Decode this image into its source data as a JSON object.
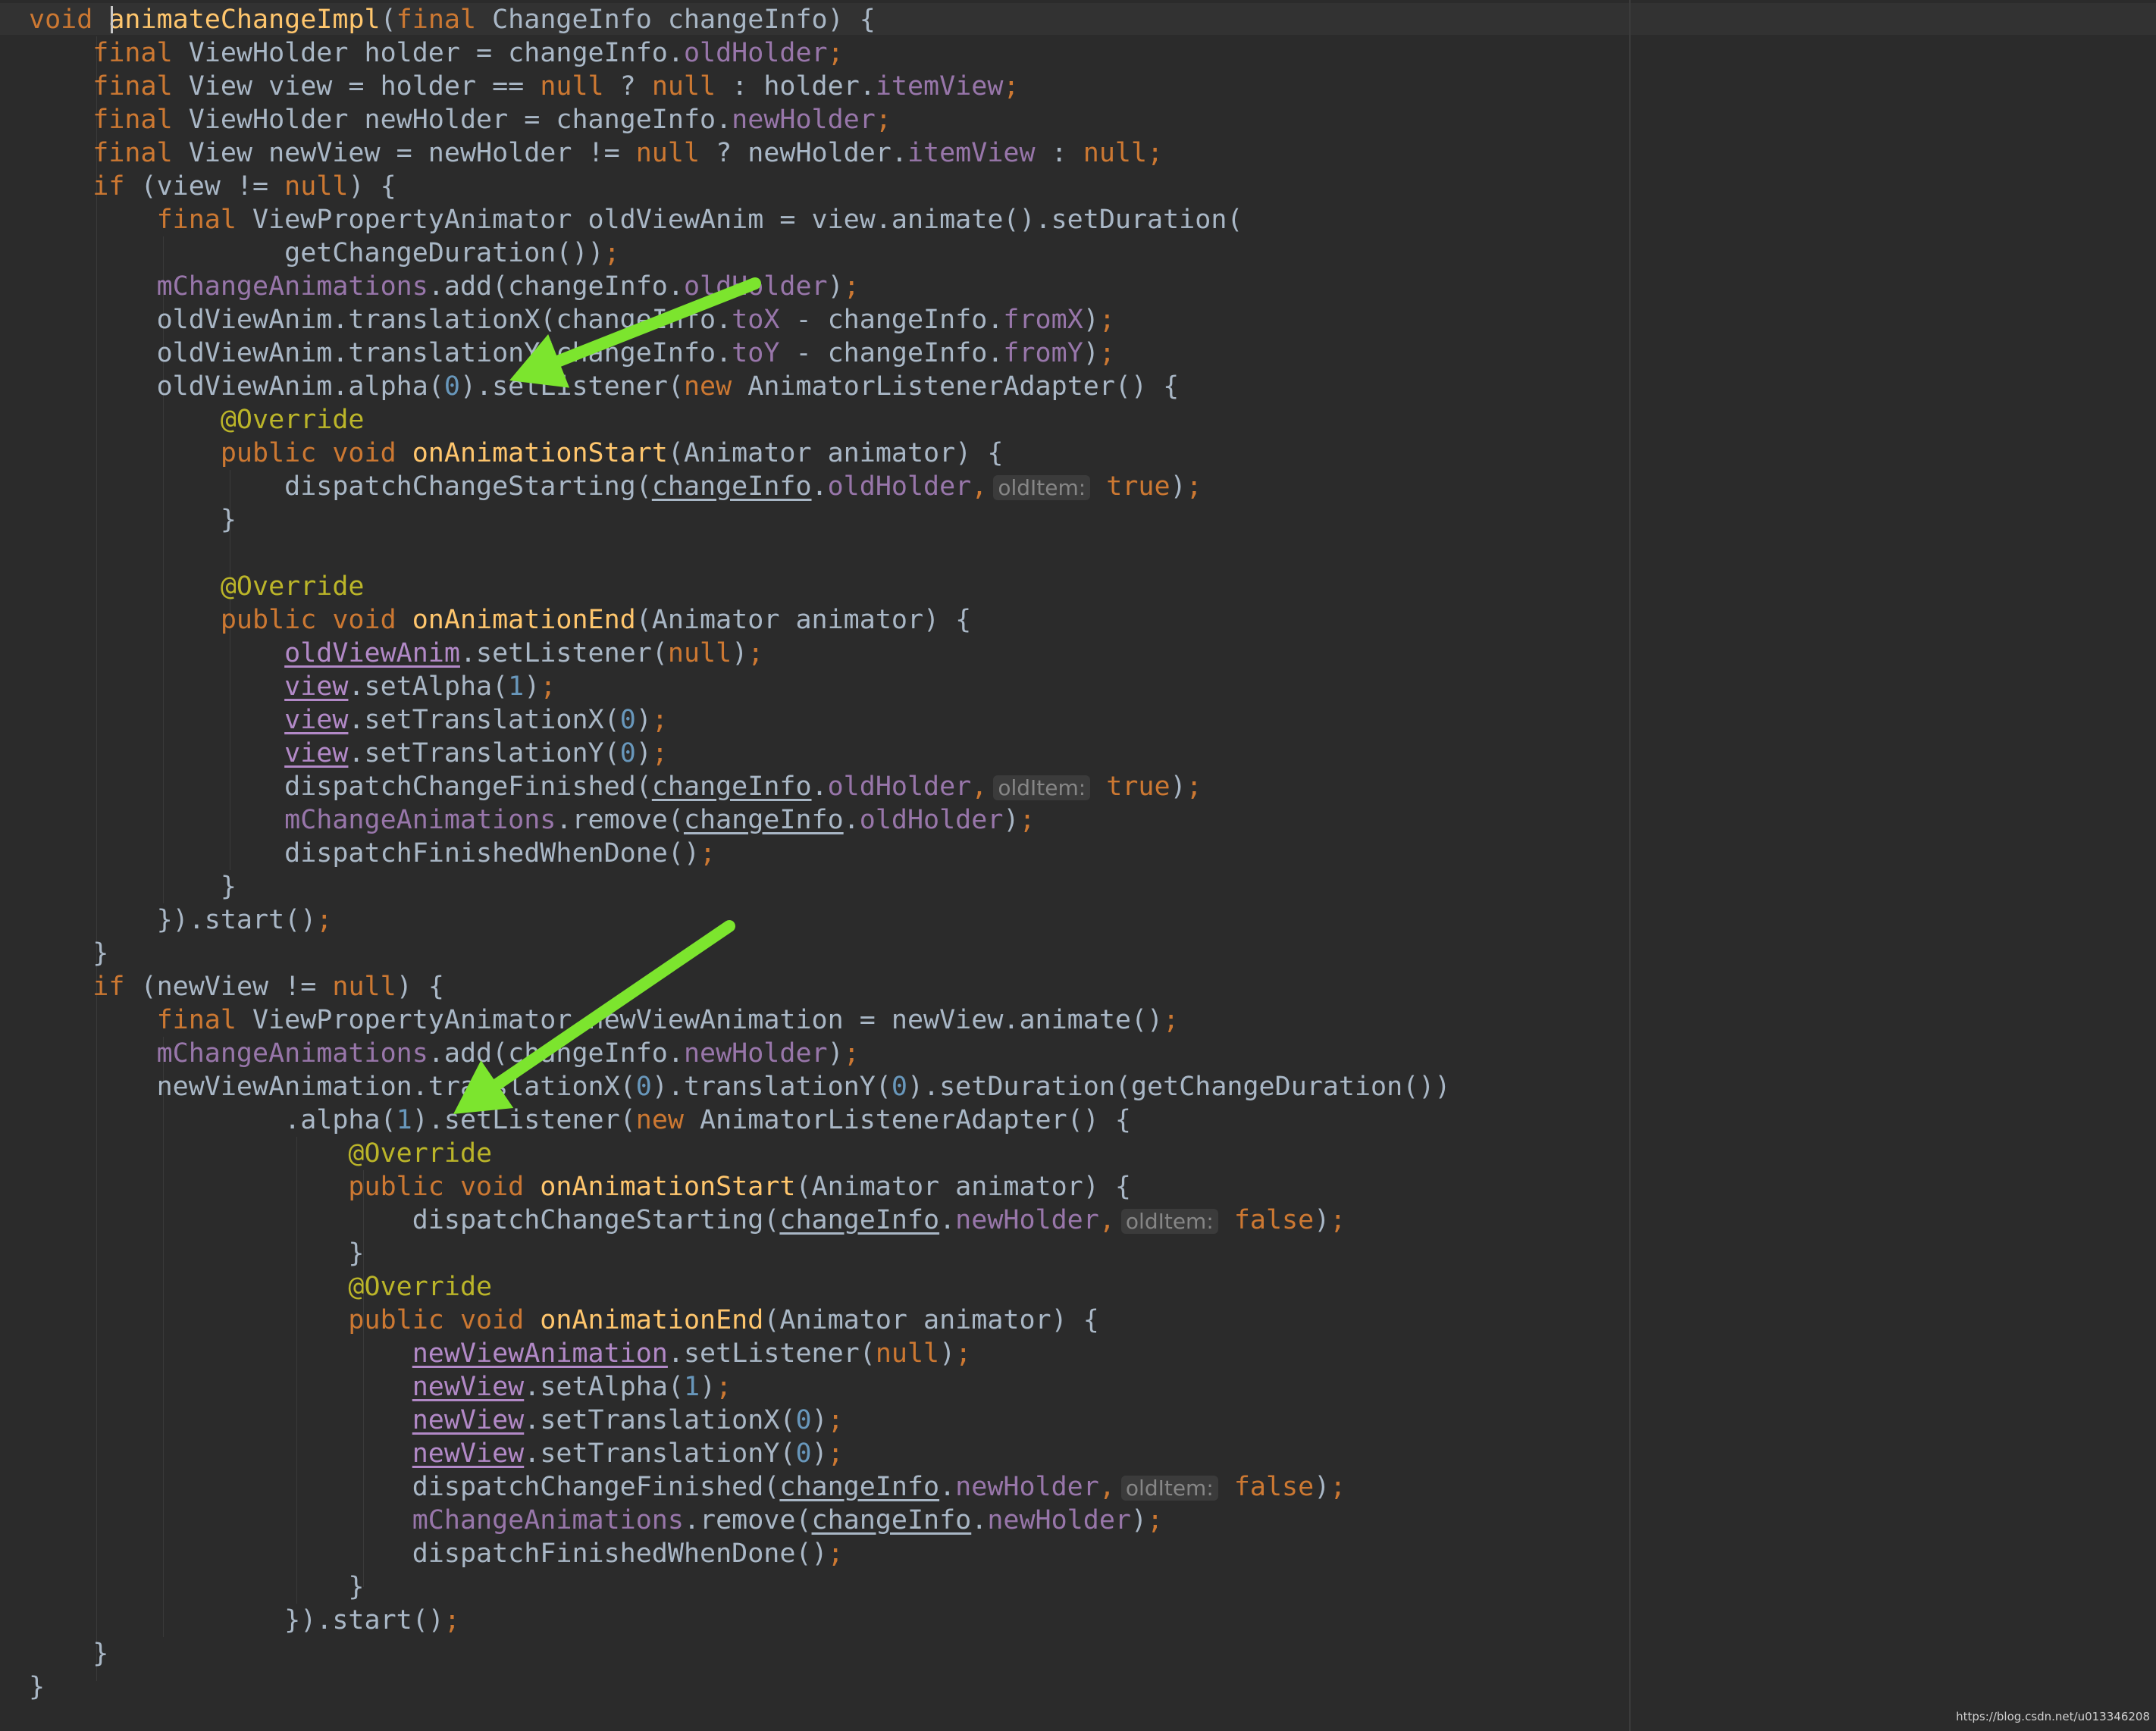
{
  "editor": {
    "caret_line": 1,
    "lines": [
      [
        [
          "kw",
          "void "
        ],
        [
          "fn",
          "animateChangeImpl"
        ],
        [
          "txt",
          "("
        ],
        [
          "kw",
          "final "
        ],
        [
          "txt",
          "ChangeInfo changeInfo) {"
        ]
      ],
      [
        [
          "kw",
          "    final "
        ],
        [
          "txt",
          "ViewHolder holder = changeInfo."
        ],
        [
          "fld",
          "oldHolder"
        ],
        [
          "kw",
          ";"
        ]
      ],
      [
        [
          "kw",
          "    final "
        ],
        [
          "txt",
          "View view = holder == "
        ],
        [
          "kw",
          "null "
        ],
        [
          "txt",
          "? "
        ],
        [
          "kw",
          "null "
        ],
        [
          "txt",
          ": holder."
        ],
        [
          "fld",
          "itemView"
        ],
        [
          "kw",
          ";"
        ]
      ],
      [
        [
          "kw",
          "    final "
        ],
        [
          "txt",
          "ViewHolder newHolder = changeInfo."
        ],
        [
          "fld",
          "newHolder"
        ],
        [
          "kw",
          ";"
        ]
      ],
      [
        [
          "kw",
          "    final "
        ],
        [
          "txt",
          "View newView = newHolder != "
        ],
        [
          "kw",
          "null "
        ],
        [
          "txt",
          "? newHolder."
        ],
        [
          "fld",
          "itemView "
        ],
        [
          "txt",
          ": "
        ],
        [
          "kw",
          "null;"
        ]
      ],
      [
        [
          "kw",
          "    if "
        ],
        [
          "txt",
          "(view != "
        ],
        [
          "kw",
          "null"
        ],
        [
          "txt",
          ") {"
        ]
      ],
      [
        [
          "kw",
          "        final "
        ],
        [
          "txt",
          "ViewPropertyAnimator oldViewAnim = view.animate().setDuration("
        ]
      ],
      [
        [
          "txt",
          "                getChangeDuration())"
        ],
        [
          "kw",
          ";"
        ]
      ],
      [
        [
          "fld",
          "        mChangeAnimations"
        ],
        [
          "txt",
          ".add(changeInfo."
        ],
        [
          "fld",
          "oldHolder"
        ],
        [
          "txt",
          ")"
        ],
        [
          "kw",
          ";"
        ]
      ],
      [
        [
          "txt",
          "        oldViewAnim.translationX(changeInfo."
        ],
        [
          "fld",
          "toX "
        ],
        [
          "txt",
          "- changeInfo."
        ],
        [
          "fld",
          "fromX"
        ],
        [
          "txt",
          ")"
        ],
        [
          "kw",
          ";"
        ]
      ],
      [
        [
          "txt",
          "        oldViewAnim.translationY(changeInfo."
        ],
        [
          "fld",
          "toY "
        ],
        [
          "txt",
          "- changeInfo."
        ],
        [
          "fld",
          "fromY"
        ],
        [
          "txt",
          ")"
        ],
        [
          "kw",
          ";"
        ]
      ],
      [
        [
          "txt",
          "        oldViewAnim.alpha("
        ],
        [
          "num",
          "0"
        ],
        [
          "txt",
          ").setListener("
        ],
        [
          "kw",
          "new "
        ],
        [
          "txt",
          "AnimatorListenerAdapter() {"
        ]
      ],
      [
        [
          "ann",
          "            @Override"
        ]
      ],
      [
        [
          "kw",
          "            public void "
        ],
        [
          "fn",
          "onAnimationStart"
        ],
        [
          "txt",
          "(Animator animator) {"
        ]
      ],
      [
        [
          "txt",
          "                dispatchChangeStarting("
        ],
        [
          "undv",
          "changeInfo"
        ],
        [
          "txt",
          "."
        ],
        [
          "fld",
          "oldHolder"
        ],
        [
          "kw",
          ","
        ],
        [
          "hint",
          "oldItem:"
        ],
        [
          "kw",
          " true"
        ],
        [
          "txt",
          ")"
        ],
        [
          "kw",
          ";"
        ]
      ],
      [
        [
          "txt",
          "            }"
        ]
      ],
      [
        [
          "txt",
          ""
        ]
      ],
      [
        [
          "ann",
          "            @Override"
        ]
      ],
      [
        [
          "kw",
          "            public void "
        ],
        [
          "fn",
          "onAnimationEnd"
        ],
        [
          "txt",
          "(Animator animator) {"
        ]
      ],
      [
        [
          "txt",
          "                "
        ],
        [
          "und",
          "oldViewAnim"
        ],
        [
          "txt",
          ".setListener("
        ],
        [
          "kw",
          "null"
        ],
        [
          "txt",
          ")"
        ],
        [
          "kw",
          ";"
        ]
      ],
      [
        [
          "txt",
          "                "
        ],
        [
          "und",
          "view"
        ],
        [
          "txt",
          ".setAlpha("
        ],
        [
          "num",
          "1"
        ],
        [
          "txt",
          ")"
        ],
        [
          "kw",
          ";"
        ]
      ],
      [
        [
          "txt",
          "                "
        ],
        [
          "und",
          "view"
        ],
        [
          "txt",
          ".setTranslationX("
        ],
        [
          "num",
          "0"
        ],
        [
          "txt",
          ")"
        ],
        [
          "kw",
          ";"
        ]
      ],
      [
        [
          "txt",
          "                "
        ],
        [
          "und",
          "view"
        ],
        [
          "txt",
          ".setTranslationY("
        ],
        [
          "num",
          "0"
        ],
        [
          "txt",
          ")"
        ],
        [
          "kw",
          ";"
        ]
      ],
      [
        [
          "txt",
          "                dispatchChangeFinished("
        ],
        [
          "undv",
          "changeInfo"
        ],
        [
          "txt",
          "."
        ],
        [
          "fld",
          "oldHolder"
        ],
        [
          "kw",
          ","
        ],
        [
          "hint",
          "oldItem:"
        ],
        [
          "kw",
          " true"
        ],
        [
          "txt",
          ")"
        ],
        [
          "kw",
          ";"
        ]
      ],
      [
        [
          "fld",
          "                mChangeAnimations"
        ],
        [
          "txt",
          ".remove("
        ],
        [
          "undv",
          "changeInfo"
        ],
        [
          "txt",
          "."
        ],
        [
          "fld",
          "oldHolder"
        ],
        [
          "txt",
          ")"
        ],
        [
          "kw",
          ";"
        ]
      ],
      [
        [
          "txt",
          "                dispatchFinishedWhenDone()"
        ],
        [
          "kw",
          ";"
        ]
      ],
      [
        [
          "txt",
          "            }"
        ]
      ],
      [
        [
          "txt",
          "        }).start()"
        ],
        [
          "kw",
          ";"
        ]
      ],
      [
        [
          "txt",
          "    }"
        ]
      ],
      [
        [
          "kw",
          "    if "
        ],
        [
          "txt",
          "(newView != "
        ],
        [
          "kw",
          "null"
        ],
        [
          "txt",
          ") {"
        ]
      ],
      [
        [
          "kw",
          "        final "
        ],
        [
          "txt",
          "ViewPropertyAnimator newViewAnimation = newView.animate()"
        ],
        [
          "kw",
          ";"
        ]
      ],
      [
        [
          "fld",
          "        mChangeAnimations"
        ],
        [
          "txt",
          ".add(changeInfo."
        ],
        [
          "fld",
          "newHolder"
        ],
        [
          "txt",
          ")"
        ],
        [
          "kw",
          ";"
        ]
      ],
      [
        [
          "txt",
          "        newViewAnimation.translationX("
        ],
        [
          "num",
          "0"
        ],
        [
          "txt",
          ").translationY("
        ],
        [
          "num",
          "0"
        ],
        [
          "txt",
          ").setDuration(getChangeDuration())"
        ]
      ],
      [
        [
          "txt",
          "                .alpha("
        ],
        [
          "num",
          "1"
        ],
        [
          "txt",
          ").setListener("
        ],
        [
          "kw",
          "new "
        ],
        [
          "txt",
          "AnimatorListenerAdapter() {"
        ]
      ],
      [
        [
          "ann",
          "                    @Override"
        ]
      ],
      [
        [
          "kw",
          "                    public void "
        ],
        [
          "fn",
          "onAnimationStart"
        ],
        [
          "txt",
          "(Animator animator) {"
        ]
      ],
      [
        [
          "txt",
          "                        dispatchChangeStarting("
        ],
        [
          "undv",
          "changeInfo"
        ],
        [
          "txt",
          "."
        ],
        [
          "fld",
          "newHolder"
        ],
        [
          "kw",
          ","
        ],
        [
          "hint",
          "oldItem:"
        ],
        [
          "kw",
          " false"
        ],
        [
          "txt",
          ")"
        ],
        [
          "kw",
          ";"
        ]
      ],
      [
        [
          "txt",
          "                    }"
        ]
      ],
      [
        [
          "ann",
          "                    @Override"
        ]
      ],
      [
        [
          "kw",
          "                    public void "
        ],
        [
          "fn",
          "onAnimationEnd"
        ],
        [
          "txt",
          "(Animator animator) {"
        ]
      ],
      [
        [
          "txt",
          "                        "
        ],
        [
          "und",
          "newViewAnimation"
        ],
        [
          "txt",
          ".setListener("
        ],
        [
          "kw",
          "null"
        ],
        [
          "txt",
          ")"
        ],
        [
          "kw",
          ";"
        ]
      ],
      [
        [
          "txt",
          "                        "
        ],
        [
          "und",
          "newView"
        ],
        [
          "txt",
          ".setAlpha("
        ],
        [
          "num",
          "1"
        ],
        [
          "txt",
          ")"
        ],
        [
          "kw",
          ";"
        ]
      ],
      [
        [
          "txt",
          "                        "
        ],
        [
          "und",
          "newView"
        ],
        [
          "txt",
          ".setTranslationX("
        ],
        [
          "num",
          "0"
        ],
        [
          "txt",
          ")"
        ],
        [
          "kw",
          ";"
        ]
      ],
      [
        [
          "txt",
          "                        "
        ],
        [
          "und",
          "newView"
        ],
        [
          "txt",
          ".setTranslationY("
        ],
        [
          "num",
          "0"
        ],
        [
          "txt",
          ")"
        ],
        [
          "kw",
          ";"
        ]
      ],
      [
        [
          "txt",
          "                        dispatchChangeFinished("
        ],
        [
          "undv",
          "changeInfo"
        ],
        [
          "txt",
          "."
        ],
        [
          "fld",
          "newHolder"
        ],
        [
          "kw",
          ","
        ],
        [
          "hint",
          "oldItem:"
        ],
        [
          "kw",
          " false"
        ],
        [
          "txt",
          ")"
        ],
        [
          "kw",
          ";"
        ]
      ],
      [
        [
          "fld",
          "                        mChangeAnimations"
        ],
        [
          "txt",
          ".remove("
        ],
        [
          "undv",
          "changeInfo"
        ],
        [
          "txt",
          "."
        ],
        [
          "fld",
          "newHolder"
        ],
        [
          "txt",
          ")"
        ],
        [
          "kw",
          ";"
        ]
      ],
      [
        [
          "txt",
          "                        dispatchFinishedWhenDone()"
        ],
        [
          "kw",
          ";"
        ]
      ],
      [
        [
          "txt",
          "                    }"
        ]
      ],
      [
        [
          "txt",
          "                }).start()"
        ],
        [
          "kw",
          ";"
        ]
      ],
      [
        [
          "txt",
          "    }"
        ]
      ],
      [
        [
          "txt",
          "}"
        ]
      ]
    ]
  },
  "annotations": {
    "arrow_color": "#7ce52e"
  },
  "watermark": "https://blog.csdn.net/u013346208"
}
